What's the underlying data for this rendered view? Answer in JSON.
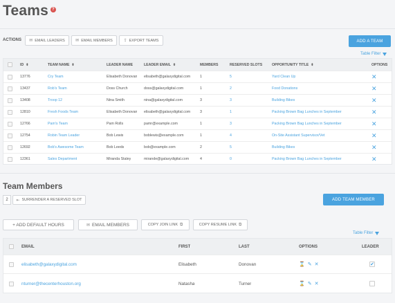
{
  "page": {
    "title": "Teams",
    "help": "?"
  },
  "actions": {
    "label": "ACTIONS",
    "email_leaders": "EMAIL LEADERS",
    "email_members": "EMAIL MEMBERS",
    "export_teams": "EXPORT TEAMS",
    "add_team": "ADD A TEAM"
  },
  "table_filter": "Table Filter",
  "teams_table": {
    "headers": {
      "id": "ID",
      "team_name": "TEAM NAME",
      "leader_name": "LEADER NAME",
      "leader_email": "LEADER EMAIL",
      "members": "MEMBERS",
      "reserved_slots": "RESERVED SLOTS",
      "opportunity_title": "OPPORTUNITY TITLE",
      "options": "OPTIONS"
    },
    "rows": [
      {
        "id": "13776",
        "team": "Cry Team",
        "leader": "Elisabeth Donovan",
        "email": "elisabeth@galaxydigital.com",
        "members": "1",
        "slots": "5",
        "opportunity": "Yard Clean Up"
      },
      {
        "id": "13437",
        "team": "Rob's Team",
        "leader": "Doss Church",
        "email": "doss@galaxydigital.com",
        "members": "1",
        "slots": "2",
        "opportunity": "Food Donations"
      },
      {
        "id": "13408",
        "team": "Troop 12",
        "leader": "Nina Smith",
        "email": "nina@galaxydigital.com",
        "members": "3",
        "slots": "3",
        "opportunity": "Building Bikes"
      },
      {
        "id": "12810",
        "team": "Fresh Foods Team",
        "leader": "Elisabeth Donovan",
        "email": "elisabeth@galaxydigital.com",
        "members": "3",
        "slots": "1",
        "opportunity": "Packing Brown Bag Lunches in September"
      },
      {
        "id": "12766",
        "team": "Pam's Team",
        "leader": "Pam Rolls",
        "email": "pamr@example.com",
        "members": "1",
        "slots": "3",
        "opportunity": "Packing Brown Bag Lunches in September"
      },
      {
        "id": "12754",
        "team": "Robin Team Leader",
        "leader": "Bob Lewis",
        "email": "boblewis@example.com",
        "members": "1",
        "slots": "4",
        "opportunity": "On-Site Assistant Supervisor/Vet"
      },
      {
        "id": "12692",
        "team": "Bob's Awesome Team",
        "leader": "Bob Leeds",
        "email": "bob@example.com",
        "members": "2",
        "slots": "5",
        "opportunity": "Building Bikes"
      },
      {
        "id": "12361",
        "team": "Sales Department",
        "leader": "Miranda Staley",
        "email": "mirande@galaxydigital.com",
        "members": "4",
        "slots": "0",
        "opportunity": "Packing Brown Bag Lunches in September"
      }
    ]
  },
  "team_members": {
    "title": "Team Members",
    "count": "2",
    "surrender": "SURRENDER A RESERVED SLOT",
    "add_member": "ADD TEAM MEMBER",
    "add_default_hours": "+ ADD DEFAULT HOURS",
    "email_members": "EMAIL MEMBERS",
    "copy_join_link": "COPY JOIN LINK",
    "copy_resume_link": "COPY RESUME LINK",
    "headers": {
      "email": "EMAIL",
      "first": "FIRST",
      "last": "LAST",
      "options": "OPTIONS",
      "leader": "LEADER"
    },
    "rows": [
      {
        "email": "elisabeth@galaxydigital.com",
        "first": "Elisabeth",
        "last": "Donovan",
        "leader": true
      },
      {
        "email": "nturner@thecenterhouston.org",
        "first": "Natasha",
        "last": "Turner",
        "leader": false
      }
    ]
  },
  "colors": {
    "accent": "#4aa3df",
    "help": "#d9534f"
  }
}
